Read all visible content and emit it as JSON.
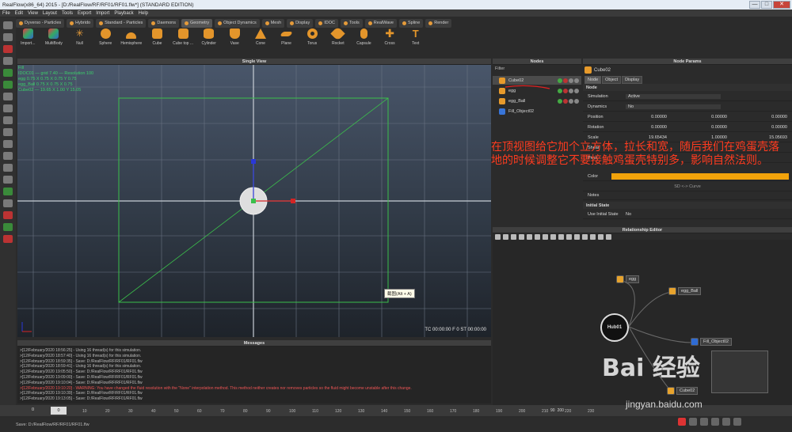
{
  "window": {
    "title": "RealFlow(x86_64) 2015 - [D:/RealFlow/RF/RF01/RF01.flw*] (STANDARD EDITION)",
    "minimize": "—",
    "maximize": "□",
    "close": "✕"
  },
  "menu": [
    "File",
    "Edit",
    "View",
    "Layout",
    "Tools",
    "Export",
    "Import",
    "Playback",
    "Help"
  ],
  "tabs": [
    {
      "label": "Dyverso - Particles",
      "active": false
    },
    {
      "label": "Hybrido",
      "active": false
    },
    {
      "label": "Standard - Particles",
      "active": false
    },
    {
      "label": "Daemons",
      "active": false
    },
    {
      "label": "Geometry",
      "active": true
    },
    {
      "label": "Object Dynamics",
      "active": false
    },
    {
      "label": "Mesh",
      "active": false
    },
    {
      "label": "Display",
      "active": false
    },
    {
      "label": "IDOC",
      "active": false
    },
    {
      "label": "Tools",
      "active": false
    },
    {
      "label": "RealWave",
      "active": false
    },
    {
      "label": "Spline",
      "active": false
    },
    {
      "label": "Render",
      "active": false
    }
  ],
  "shelf": [
    "Import...",
    "MultiBody",
    "Null",
    "Sphere",
    "Hemisphere",
    "Cube",
    "Cube top ...",
    "Cylinder",
    "Vase",
    "Cone",
    "Plane",
    "Torus",
    "Rocket",
    "Capsule",
    "Cross",
    "Text"
  ],
  "viewport": {
    "title": "Single View",
    "status_lines": [
      "Fill",
      "IDOC01 — grid 7.40 — Resolution 100",
      "egg 0.75 X 0.75 X 0.75 Y 0.75",
      "egg_Ball 0.75 X 0.75 X 0.75",
      "Cube02 — 19.65 X 1.00 Y 15.05"
    ],
    "timecode": "TC 00:00:00    F 0    ST 00:00:00",
    "tooltip": "截图(Alt + A)"
  },
  "messages": {
    "title": "Messages",
    "lines": [
      {
        "text": ">[12/February/2020 18:56:25] - Using 16 thread(s) for this simulation.",
        "warn": false
      },
      {
        "text": ">[12/February/2020 18:57:40] - Using 16 thread(s) for this simulation.",
        "warn": false
      },
      {
        "text": ">[12/February/2020 18:59:35] - Save: D:/RealFlow/RF/RF01/RF01.flw",
        "warn": false
      },
      {
        "text": ">[12/February/2020 18:59:41] - Using 16 thread(s) for this simulation.",
        "warn": false
      },
      {
        "text": ">[12/February/2020 19:05:50] - Save: D:/RealFlow/RF/RF01/RF01.flw",
        "warn": false
      },
      {
        "text": ">[12/February/2020 19:09:00] - Save: D:/RealFlow/RF/RF01/RF01.flw",
        "warn": false
      },
      {
        "text": ">[12/February/2020 19:10:04] - Save: D:/RealFlow/RF/RF01/RF01.flw",
        "warn": false
      },
      {
        "text": ">[12/February/2020 19:10:20] - WARNING: You have changed the fluid resolution with the \"None\" interpolation method. This method neither creates nor removes particles so the fluid might become unstable after this change.",
        "warn": true
      },
      {
        "text": ">[12/February/2020 19:10:39] - Save: D:/RealFlow/RF/RF01/RF01.flw",
        "warn": false
      },
      {
        "text": ">[12/February/2020 19:13:05] - Save: D:/RealFlow/RF/RF01/RF01.flw",
        "warn": false
      }
    ]
  },
  "nodes": {
    "title": "Nodes",
    "filter": "Filter",
    "items": [
      {
        "name": "Cube02",
        "selected": true,
        "color": "orange"
      },
      {
        "name": "egg",
        "selected": false,
        "color": "orange"
      },
      {
        "name": "egg_Ball",
        "selected": false,
        "color": "orange"
      },
      {
        "name": "Fill_Object02",
        "selected": false,
        "color": "blue"
      }
    ]
  },
  "params": {
    "title": "Node Params",
    "node_name": "Cube02",
    "tabs": [
      "Node",
      "Object",
      "Display"
    ],
    "section_node": "Node",
    "simulation_label": "Simulation",
    "simulation_value": "Active",
    "dynamics_label": "Dynamics",
    "dynamics_value": "No",
    "position_label": "Position",
    "position": [
      "0.00000",
      "0.00000",
      "0.00000"
    ],
    "rotation_label": "Rotation",
    "rotation": [
      "0.00000",
      "0.00000",
      "0.00000"
    ],
    "scale_label": "Scale",
    "scale": [
      "19.65434",
      "1.00000",
      "15.05693"
    ],
    "shear_label": "Shear",
    "pivot_label": "Pivot",
    "color_label": "Color",
    "color_value": "#f2a30b",
    "sd_curve": "SD <-> Curve",
    "notes_label": "Notes",
    "initial_state": "Initial State",
    "use_initial_state": "Use Initial State",
    "use_initial_value": "No"
  },
  "relationship": {
    "title": "Relationship Editor",
    "hub": "Hub01",
    "nodes": [
      "egg",
      "egg_Ball",
      "Fill_Object02",
      "Cube02"
    ]
  },
  "annotation": "在顶视图给它加个立方体，拉长和宽，随后我们在鸡蛋壳落地的时候调整它不要接触鸡蛋壳特别多，影响自然法则。",
  "timeline": {
    "field": "0",
    "frame": "0",
    "ticks": [
      "10",
      "20",
      "30",
      "40",
      "50",
      "60",
      "70",
      "80",
      "90",
      "100",
      "110",
      "120",
      "130",
      "140",
      "150",
      "160",
      "170",
      "180",
      "190",
      "200",
      "210",
      "220",
      "230"
    ],
    "right_values": [
      "90",
      "200"
    ]
  },
  "status": {
    "text": "Save: D:/RealFlow/RF/RF01/RF01.flw"
  },
  "watermark": {
    "brand": "Bai 经验",
    "url": "jingyan.baidu.com"
  },
  "colors": {
    "accent": "#e59b3a",
    "annotation": "#ff3b1f",
    "green": "#3cd06a"
  }
}
